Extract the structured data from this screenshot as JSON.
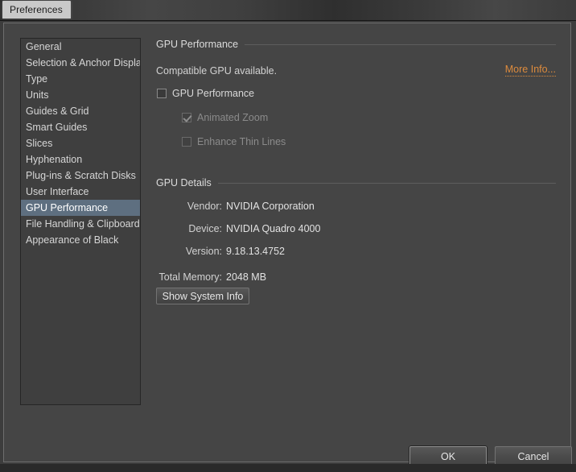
{
  "window": {
    "title": "Preferences"
  },
  "sidebar": {
    "items": [
      {
        "label": "General",
        "selected": false
      },
      {
        "label": "Selection & Anchor Display",
        "selected": false
      },
      {
        "label": "Type",
        "selected": false
      },
      {
        "label": "Units",
        "selected": false
      },
      {
        "label": "Guides & Grid",
        "selected": false
      },
      {
        "label": "Smart Guides",
        "selected": false
      },
      {
        "label": "Slices",
        "selected": false
      },
      {
        "label": "Hyphenation",
        "selected": false
      },
      {
        "label": "Plug-ins & Scratch Disks",
        "selected": false
      },
      {
        "label": "User Interface",
        "selected": false
      },
      {
        "label": "GPU Performance",
        "selected": true
      },
      {
        "label": "File Handling & Clipboard",
        "selected": false
      },
      {
        "label": "Appearance of Black",
        "selected": false
      }
    ]
  },
  "pane": {
    "section_gpu_performance": {
      "heading": "GPU Performance",
      "status_text": "Compatible GPU available.",
      "more_info_label": "More Info...",
      "checkbox_gpu_performance": {
        "label": "GPU Performance",
        "checked": false,
        "disabled": false
      },
      "checkbox_animated_zoom": {
        "label": "Animated Zoom",
        "checked": true,
        "disabled": true
      },
      "checkbox_enhance_thin_lines": {
        "label": "Enhance Thin Lines",
        "checked": false,
        "disabled": true
      }
    },
    "section_gpu_details": {
      "heading": "GPU Details",
      "rows": [
        {
          "label": "Vendor:",
          "value": "NVIDIA Corporation"
        },
        {
          "label": "Device:",
          "value": "NVIDIA Quadro 4000"
        },
        {
          "label": "Version:",
          "value": "9.18.13.4752"
        }
      ],
      "total_memory_label": "Total Memory:",
      "total_memory_value": "2048 MB",
      "show_system_info_label": "Show System Info"
    }
  },
  "footer": {
    "ok_label": "OK",
    "cancel_label": "Cancel"
  },
  "colors": {
    "accent_link": "#dd8b3d",
    "selection": "#5e6f80",
    "dialog_bg": "#454545",
    "titlebar_tab_bg": "#c9c9c9"
  }
}
